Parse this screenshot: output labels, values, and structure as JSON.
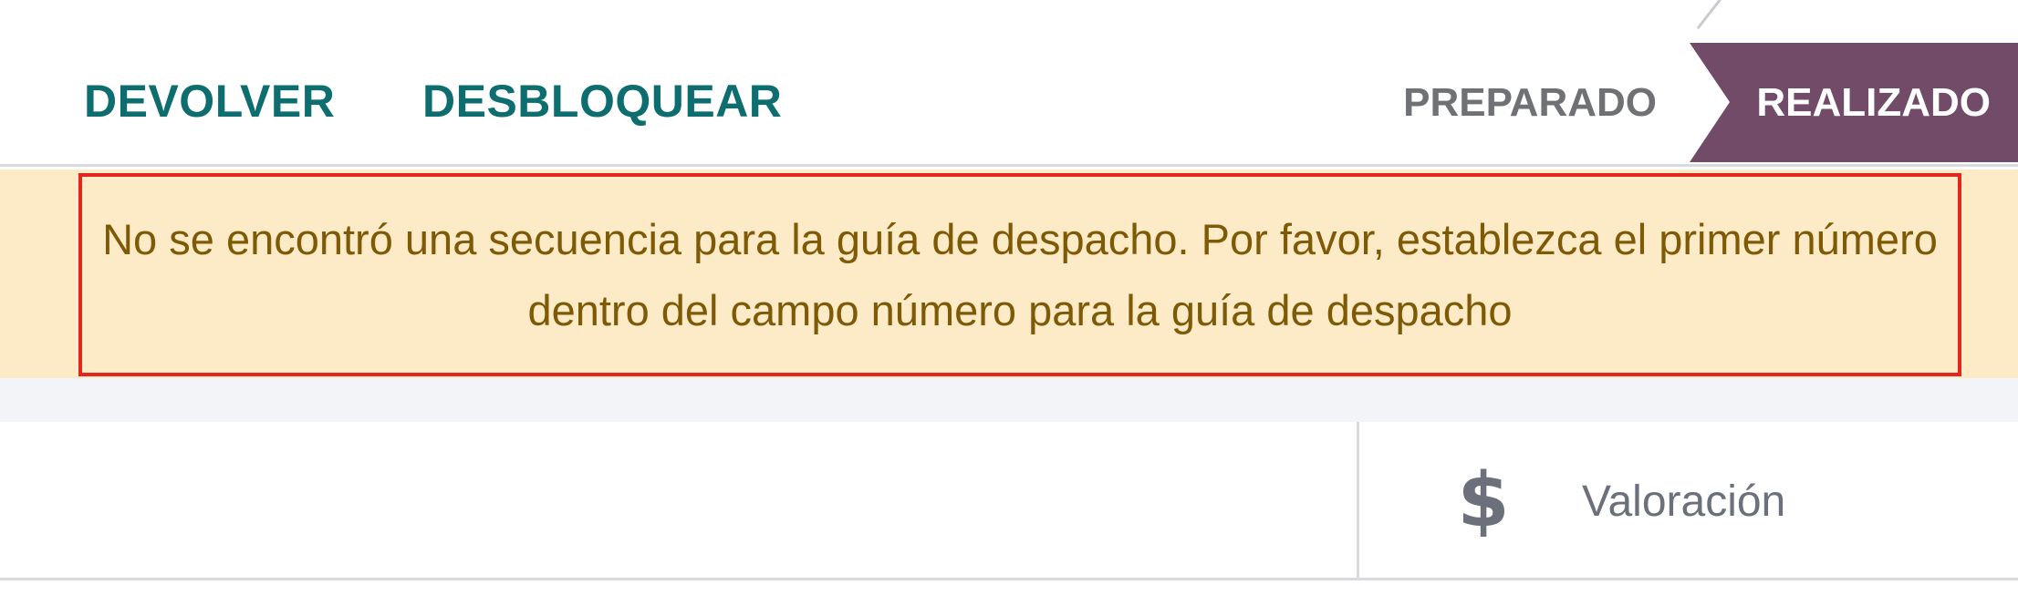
{
  "toolbar": {
    "return_label": "DEVOLVER",
    "unlock_label": "DESBLOQUEAR"
  },
  "status": {
    "stages": [
      {
        "label": "PREPARADO",
        "active": false
      },
      {
        "label": "REALIZADO",
        "active": true
      }
    ],
    "active_color": "#714b67"
  },
  "alert": {
    "message": "No se encontró una secuencia para la guía de despacho. Por favor, establezca el primer número dentro del campo número para la guía de despacho",
    "background": "#fdebc8",
    "border_color": "#e2271c"
  },
  "smart_buttons": [
    {
      "icon": "dollar-icon",
      "label": "Valoración"
    }
  ],
  "colors": {
    "action_text": "#0d6d6f",
    "muted_text": "#6b707a"
  }
}
